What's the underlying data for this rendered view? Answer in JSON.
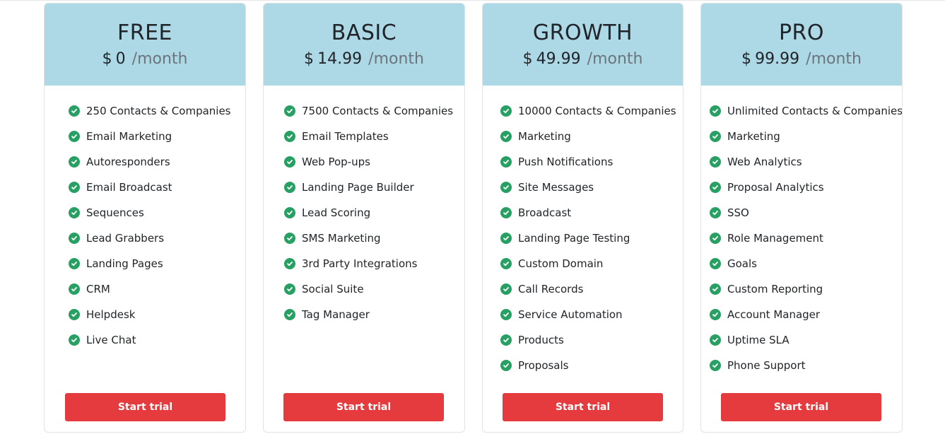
{
  "accent": {
    "header_bg": "#add8e6",
    "check_color": "#28a063",
    "button_bg": "#e53b3f"
  },
  "icon": "check-circle-icon",
  "plans": [
    {
      "name": "FREE",
      "currency": "$",
      "price": "0",
      "period": "/month",
      "features": [
        "250 Contacts & Companies",
        "Email Marketing",
        "Autoresponders",
        "Email Broadcast",
        "Sequences",
        "Lead Grabbers",
        "Landing Pages",
        "CRM",
        "Helpdesk",
        "Live Chat"
      ],
      "button_label": "Start trial"
    },
    {
      "name": "BASIC",
      "currency": "$",
      "price": "14.99",
      "period": "/month",
      "features": [
        "7500 Contacts & Companies",
        "Email Templates",
        "Web Pop-ups",
        "Landing Page Builder",
        "Lead Scoring",
        "SMS Marketing",
        "3rd Party Integrations",
        "Social Suite",
        "Tag Manager"
      ],
      "button_label": "Start trial"
    },
    {
      "name": "GROWTH",
      "currency": "$",
      "price": "49.99",
      "period": "/month",
      "features": [
        "10000 Contacts & Companies",
        "Marketing",
        "Push Notifications",
        "Site Messages",
        "Broadcast",
        "Landing Page Testing",
        "Custom Domain",
        "Call Records",
        "Service Automation",
        "Products",
        "Proposals"
      ],
      "button_label": "Start trial"
    },
    {
      "name": "PRO",
      "currency": "$",
      "price": "99.99",
      "period": "/month",
      "features": [
        "Unlimited Contacts & Companies",
        "Marketing",
        "Web Analytics",
        "Proposal Analytics",
        "SSO",
        "Role Management",
        "Goals",
        "Custom Reporting",
        "Account Manager",
        "Uptime SLA",
        "Phone Support"
      ],
      "button_label": "Start trial"
    }
  ]
}
